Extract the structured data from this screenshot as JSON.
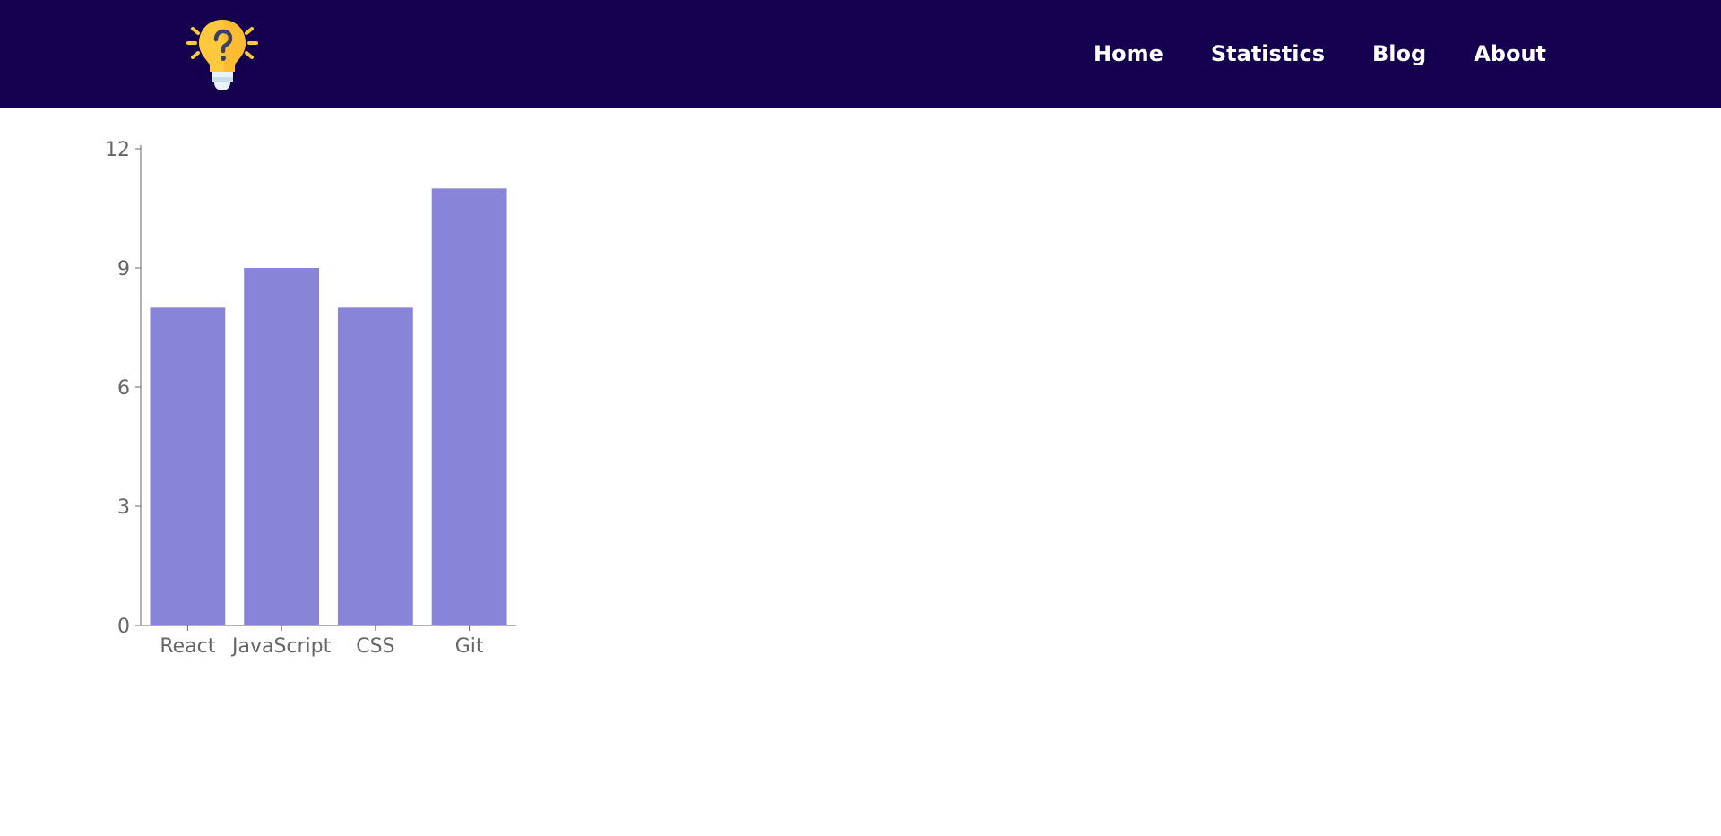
{
  "header": {
    "logo_icon": "lightbulb-question-icon",
    "nav": [
      {
        "label": "Home"
      },
      {
        "label": "Statistics"
      },
      {
        "label": "Blog"
      },
      {
        "label": "About"
      }
    ],
    "colors": {
      "background": "#150050",
      "text": "#ffffff",
      "logo": "#FFC83D"
    }
  },
  "chart_data": {
    "type": "bar",
    "categories": [
      "React",
      "JavaScript",
      "CSS",
      "Git"
    ],
    "values": [
      8,
      9,
      8,
      11
    ],
    "yticks": [
      0,
      3,
      6,
      9,
      12
    ],
    "ylim": [
      0,
      12
    ],
    "bar_color": "#8884d8",
    "axis_color": "#666666",
    "grid": false
  }
}
